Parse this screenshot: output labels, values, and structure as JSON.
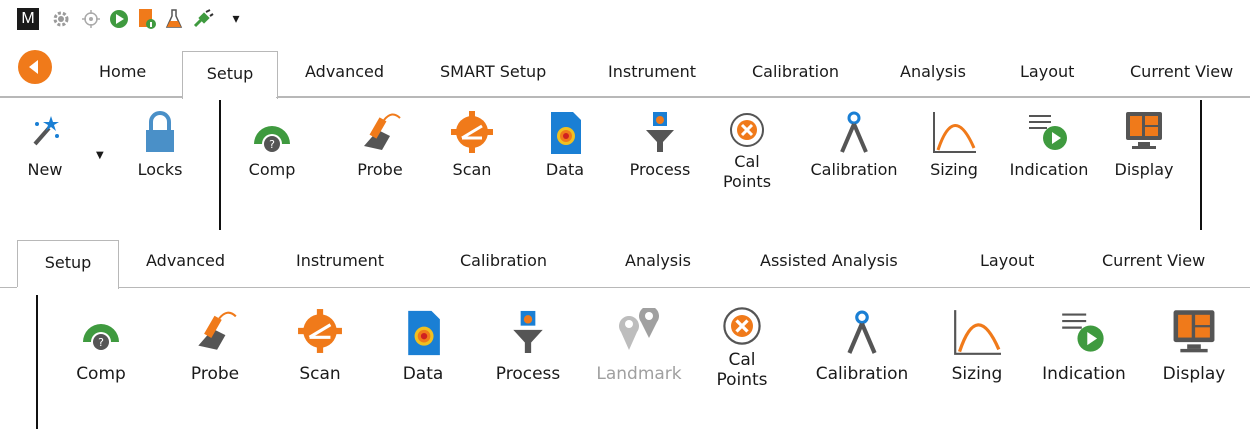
{
  "qat": {
    "logo_letter": "M",
    "overflow_glyph": "▾",
    "icons": [
      "app-logo",
      "gear-icon",
      "crosshair-icon",
      "play-icon",
      "document-info-icon",
      "flask-icon",
      "plug-icon",
      "customize-toolbar-icon"
    ]
  },
  "ribbon1": {
    "tabs": [
      "Home",
      "Setup",
      "Advanced",
      "SMART Setup",
      "Instrument",
      "Calibration",
      "Analysis",
      "Layout",
      "Current View"
    ],
    "selected_tab": "Setup",
    "buttons": {
      "new": "New",
      "locks": "Locks",
      "comp": "Comp",
      "probe": "Probe",
      "scan": "Scan",
      "data": "Data",
      "process": "Process",
      "cal_points_1": "Cal",
      "cal_points_2": "Points",
      "calibration": "Calibration",
      "sizing": "Sizing",
      "indication": "Indication",
      "display": "Display"
    }
  },
  "ribbon2": {
    "tabs": [
      "Setup",
      "Advanced",
      "Instrument",
      "Calibration",
      "Analysis",
      "Assisted Analysis",
      "Layout",
      "Current View"
    ],
    "selected_tab": "Setup",
    "buttons": {
      "comp": "Comp",
      "probe": "Probe",
      "scan": "Scan",
      "data": "Data",
      "process": "Process",
      "landmark": "Landmark",
      "cal_points_1": "Cal",
      "cal_points_2": "Points",
      "calibration": "Calibration",
      "sizing": "Sizing",
      "indication": "Indication",
      "display": "Display"
    }
  },
  "colors": {
    "green": "#3f9a3f",
    "orange": "#f07a1a",
    "blue": "#1a7fd4",
    "gray": "#555555",
    "disabled": "#a0a0a0"
  }
}
